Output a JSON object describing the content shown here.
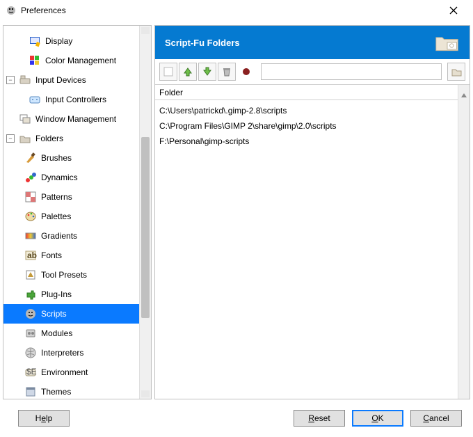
{
  "window": {
    "title": "Preferences"
  },
  "tree": {
    "display": "Display",
    "color_mgmt": "Color Management",
    "input_devices": "Input Devices",
    "input_controllers": "Input Controllers",
    "window_mgmt": "Window Management",
    "folders": "Folders",
    "brushes": "Brushes",
    "dynamics": "Dynamics",
    "patterns": "Patterns",
    "palettes": "Palettes",
    "gradients": "Gradients",
    "fonts": "Fonts",
    "tool_presets": "Tool Presets",
    "plug_ins": "Plug-Ins",
    "scripts": "Scripts",
    "modules": "Modules",
    "interpreters": "Interpreters",
    "environment": "Environment",
    "themes": "Themes"
  },
  "banner": {
    "title": "Script-Fu Folders"
  },
  "toolbar": {
    "path_value": ""
  },
  "list": {
    "header": "Folder",
    "rows": [
      "C:\\Users\\patrickd\\.gimp-2.8\\scripts",
      "C:\\Program Files\\GIMP 2\\share\\gimp\\2.0\\scripts",
      "F:\\Personal\\gimp-scripts"
    ]
  },
  "footer": {
    "help_pre": "H",
    "help_u": "e",
    "help_post": "lp",
    "reset_u": "R",
    "reset_post": "eset",
    "ok_u": "O",
    "ok_post": "K",
    "cancel_u": "C",
    "cancel_post": "ancel"
  }
}
